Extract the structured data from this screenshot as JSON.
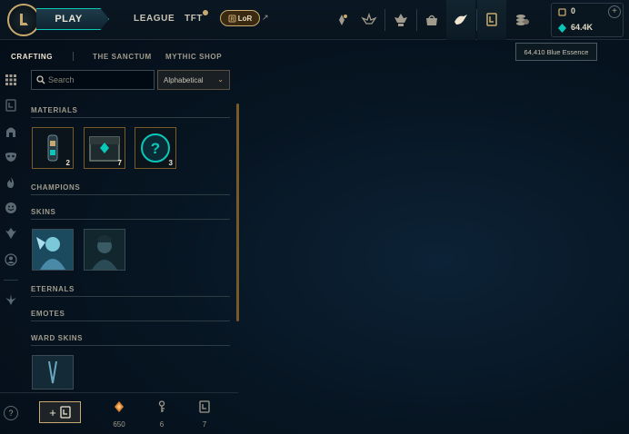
{
  "header": {
    "play_label": "PLAY",
    "nav": [
      {
        "label": "LEAGUE"
      },
      {
        "label": "TFT"
      }
    ],
    "lor_label": "LoR",
    "lor_arrow": "↗",
    "icons": [
      "shop-upgrade-icon",
      "clash-icon",
      "ranked-icon",
      "store-icon",
      "missions-icon",
      "loot-icon",
      "collection-icon"
    ],
    "currency": {
      "rp": "0",
      "blue_essence": "64.4K"
    },
    "tooltip": "64,410 Blue Essence"
  },
  "subtabs": [
    {
      "label": "CRAFTING",
      "active": true
    },
    {
      "label": "THE SANCTUM",
      "active": false
    },
    {
      "label": "MYTHIC SHOP",
      "active": false
    }
  ],
  "filters": {
    "search_placeholder": "Search",
    "sort_value": "Alphabetical"
  },
  "sections": {
    "materials": {
      "title": "MATERIALS",
      "items": [
        {
          "name": "key-fragment-capsule",
          "count": "2"
        },
        {
          "name": "hextech-chest",
          "count": "7"
        },
        {
          "name": "mystery-orb",
          "count": "3"
        }
      ]
    },
    "champions": {
      "title": "CHAMPIONS"
    },
    "skins": {
      "title": "SKINS"
    },
    "eternals": {
      "title": "ETERNALS"
    },
    "emotes": {
      "title": "EMOTES"
    },
    "ward_skins": {
      "title": "WARD SKINS"
    }
  },
  "footer": {
    "help": "?",
    "add_plus": "+",
    "counts": {
      "orange_essence": "650",
      "keys": "6",
      "chests": "7"
    }
  },
  "colors": {
    "gold": "#c8aa6e",
    "teal": "#0ac8b9",
    "bg": "#071522"
  }
}
